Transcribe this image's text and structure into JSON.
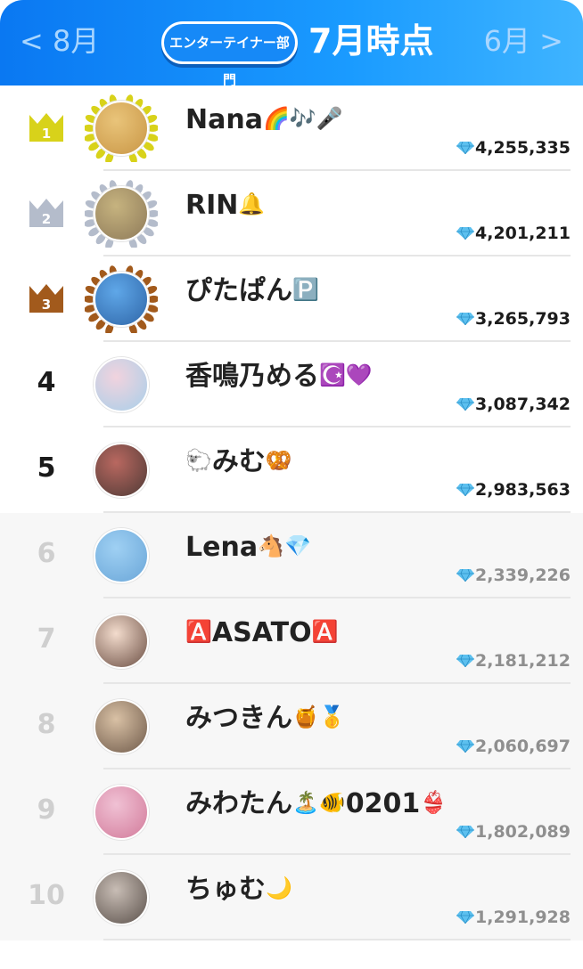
{
  "header": {
    "prev_label": "< 8月",
    "next_label": "6月 >",
    "category_label": "エンターテイナー部門",
    "title": "7月時点"
  },
  "colors": {
    "header_start": "#0a78f2",
    "header_end": "#3fb4ff",
    "gold": "#d8d21a",
    "silver": "#b4bccb",
    "bronze": "#a25a1c",
    "diamond": "#5cc0ef"
  },
  "rankings": [
    {
      "rank": "1",
      "name": "Nana",
      "emoji": "🌈🎶🎤",
      "score": "4,255,335",
      "crown": "gold",
      "avatar": [
        "#e9c47a",
        "#c99645"
      ]
    },
    {
      "rank": "2",
      "name": "RIN",
      "emoji": "🔔",
      "score": "4,201,211",
      "crown": "silver",
      "avatar": [
        "#c6b37f",
        "#8e7a59"
      ]
    },
    {
      "rank": "3",
      "name": "ぴたぱん",
      "emoji": "🅿️",
      "score": "3,265,793",
      "crown": "bronze",
      "avatar": [
        "#5fa7e8",
        "#2f66a8"
      ]
    },
    {
      "rank": "4",
      "name": "香鳴乃める",
      "emoji": "☪️💜",
      "score": "3,087,342",
      "crown": null,
      "avatar": [
        "#f1d3de",
        "#a8cfe9"
      ]
    },
    {
      "rank": "5",
      "name": "みむ",
      "prefix": "🐑",
      "emoji": "🥨",
      "score": "2,983,563",
      "crown": null,
      "avatar": [
        "#b96860",
        "#4e3a36"
      ]
    },
    {
      "rank": "6",
      "name": "Lena",
      "emoji": "🐴💎",
      "score": "2,339,226",
      "crown": null,
      "avatar": [
        "#9fd0f3",
        "#6aa6d8"
      ]
    },
    {
      "rank": "7",
      "name": "ASATO",
      "prefix": "🅰️",
      "emoji": "🅰️",
      "score": "2,181,212",
      "crown": null,
      "avatar": [
        "#f3dccd",
        "#6b4e43"
      ]
    },
    {
      "rank": "8",
      "name": "みつきん",
      "emoji": "🍯🥇",
      "score": "2,060,697",
      "crown": null,
      "avatar": [
        "#d9c1a5",
        "#6f5a4a"
      ]
    },
    {
      "rank": "9",
      "name": "みわたん",
      "emoji": "🏝️🐠",
      "suffix": "0201",
      "suffix_emoji": "👙",
      "score": "1,802,089",
      "crown": null,
      "avatar": [
        "#f0c1d4",
        "#d27a9a"
      ]
    },
    {
      "rank": "10",
      "name": "ちゅむ",
      "emoji": "🌙",
      "score": "1,291,928",
      "crown": null,
      "avatar": [
        "#c8bdb5",
        "#5a504a"
      ]
    }
  ]
}
